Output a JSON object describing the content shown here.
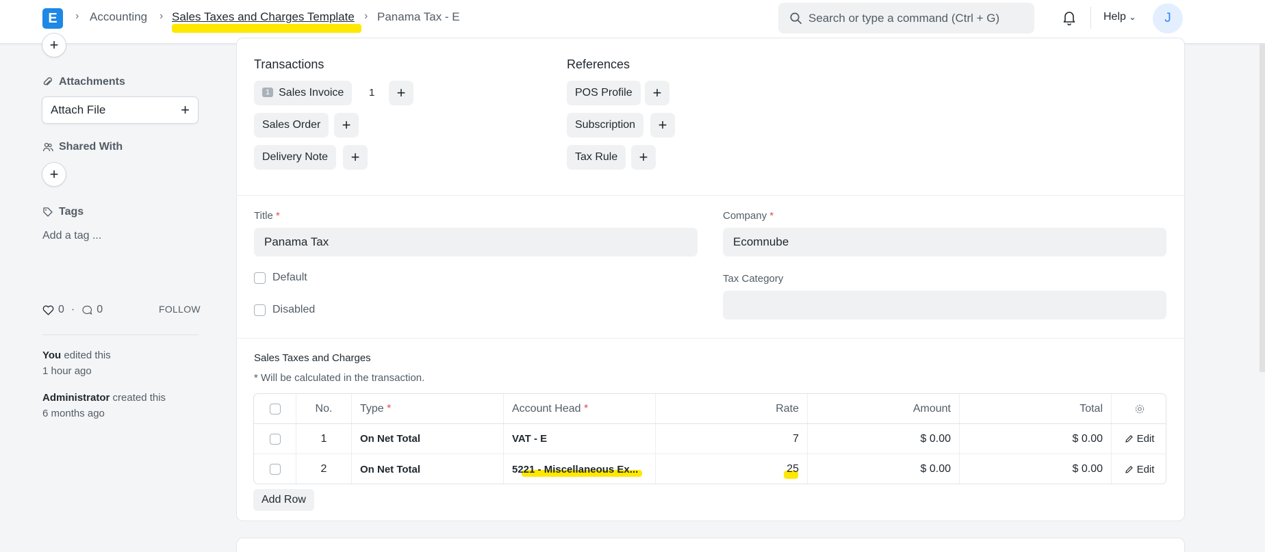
{
  "navbar": {
    "logo": "E",
    "breadcrumbs": [
      "Accounting",
      "Sales Taxes and Charges Template",
      "Panama Tax - E"
    ],
    "search_placeholder": "Search or type a command (Ctrl + G)",
    "help_label": "Help",
    "avatar_initial": "J"
  },
  "sidebar": {
    "attachments_label": "Attachments",
    "attach_file_label": "Attach File",
    "shared_with_label": "Shared With",
    "tags_label": "Tags",
    "add_tag_label": "Add a tag ...",
    "likes": "0",
    "comments": "0",
    "follow_label": "FOLLOW",
    "activity": [
      {
        "actor": "You",
        "action": " edited this",
        "time": "1 hour ago"
      },
      {
        "actor": "Administrator",
        "action": " created this",
        "time": "6 months ago"
      }
    ]
  },
  "connections": {
    "transactions_title": "Transactions",
    "references_title": "References",
    "transactions": [
      {
        "label": "Sales Invoice",
        "count": "1",
        "side_count": "1"
      },
      {
        "label": "Sales Order"
      },
      {
        "label": "Delivery Note"
      }
    ],
    "references": [
      {
        "label": "POS Profile"
      },
      {
        "label": "Subscription"
      },
      {
        "label": "Tax Rule"
      }
    ]
  },
  "form": {
    "title_label": "Title",
    "title_value": "Panama Tax",
    "company_label": "Company",
    "company_value": "Ecomnube",
    "default_label": "Default",
    "disabled_label": "Disabled",
    "tax_category_label": "Tax Category",
    "tax_category_value": "",
    "required_mark": "*"
  },
  "taxes": {
    "section_label": "Sales Taxes and Charges",
    "note": "* Will be calculated in the transaction.",
    "columns": {
      "no": "No.",
      "type": "Type",
      "account_head": "Account Head",
      "rate": "Rate",
      "amount": "Amount",
      "total": "Total"
    },
    "rows": [
      {
        "no": "1",
        "type": "On Net Total",
        "account_head": "VAT - E",
        "rate": "7",
        "amount": "$ 0.00",
        "total": "$ 0.00",
        "edit": "Edit"
      },
      {
        "no": "2",
        "type": "On Net Total",
        "account_head": "5221 - Miscellaneous Ex...",
        "rate": "25",
        "amount": "$ 0.00",
        "total": "$ 0.00",
        "edit": "Edit"
      }
    ],
    "add_row_label": "Add Row"
  },
  "colors": {
    "accent": "#1e88e5",
    "highlight": "#ffe800",
    "required": "#e24c4c"
  }
}
